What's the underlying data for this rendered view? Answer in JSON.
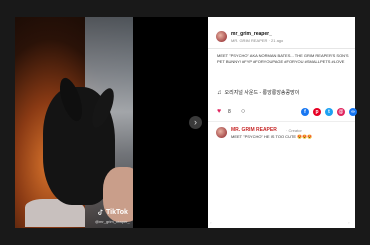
{
  "post": {
    "username": "mr_grim_reaper_",
    "meta": "MR. GRIM REAPER · 21 ago",
    "caption": "MEET \"PSYCHO\" AKA NORMAN BATES... THE GRIM REAPER'S SON'S PET BUNNY! #FYP #FORYOUPAGE #FORYOU #SMALLPETS #LOVE",
    "music": "오리지널 사운드 - 롱앙롱앙송콩망이",
    "likes": "8",
    "watermark": "TikTok",
    "watermark_user": "@mr_grim_reaper_"
  },
  "comment": {
    "author": "MR. GRIM REAPER",
    "time": "· Creator",
    "text": "MEET \"PSYCHO\" HE IS TOO CUTE 😍😍😍"
  },
  "share_buttons": [
    {
      "name": "facebook",
      "label": "f",
      "color": "#1877f2"
    },
    {
      "name": "pinterest",
      "label": "p",
      "color": "#e60023"
    },
    {
      "name": "twitter",
      "label": "t",
      "color": "#1da1f2"
    },
    {
      "name": "email",
      "label": "@",
      "color": "#e0245e"
    },
    {
      "name": "link",
      "label": "∞",
      "color": "#1877f2"
    }
  ],
  "nav": {
    "next_arrow": "›"
  }
}
